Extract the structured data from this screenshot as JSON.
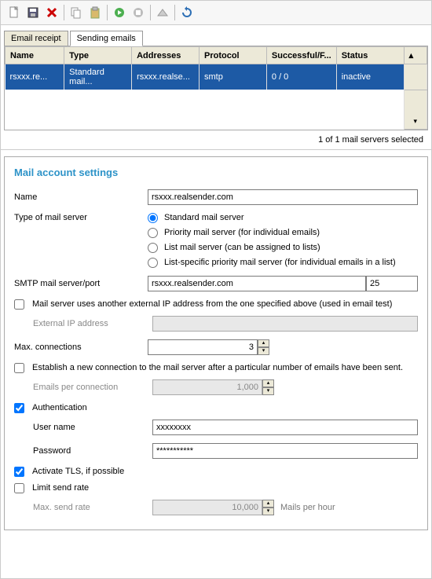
{
  "toolbar": {
    "icons": [
      "new",
      "save",
      "delete",
      "copy",
      "paste",
      "run",
      "stop",
      "send",
      "refresh"
    ]
  },
  "tabs": {
    "email_receipt": "Email receipt",
    "sending_emails": "Sending emails"
  },
  "table": {
    "headers": {
      "name": "Name",
      "type": "Type",
      "addresses": "Addresses",
      "protocol": "Protocol",
      "successful": "Successful/F...",
      "status": "Status"
    },
    "rows": [
      {
        "name": "rsxxx.re...",
        "type": "Standard mail...",
        "addresses": "rsxxx.realse...",
        "protocol": "smtp",
        "successful": "0 / 0",
        "status": "inactive"
      }
    ]
  },
  "status": {
    "text": "1 of 1 mail servers selected"
  },
  "panel": {
    "title": "Mail account settings",
    "labels": {
      "name": "Name",
      "type": "Type of mail server",
      "smtp": "SMTP mail server/port",
      "ext_ip_chk": "Mail server uses another external IP address from the one specified above (used in email test)",
      "ext_ip": "External IP address",
      "max_conn": "Max. connections",
      "establish": "Establish a new connection to the mail server after a particular number of emails have been sent.",
      "emails_per_conn": "Emails per connection",
      "auth": "Authentication",
      "user": "User name",
      "pass": "Password",
      "tls": "Activate TLS, if possible",
      "limit": "Limit send rate",
      "max_rate": "Max. send rate",
      "mails_per_hour": "Mails per hour"
    },
    "values": {
      "name": "rsxxx.realsender.com",
      "smtp_host": "rsxxx.realsender.com",
      "smtp_port": "25",
      "max_conn": "3",
      "emails_per_conn": "1,000",
      "user": "xxxxxxxx",
      "pass": "***********",
      "max_rate": "10,000"
    },
    "radios": {
      "standard": "Standard mail server",
      "priority": "Priority mail server (for individual emails)",
      "list": "List mail server (can be assigned to lists)",
      "list_spec": "List-specific priority mail server (for individual emails in a list)"
    },
    "checks": {
      "ext_ip": false,
      "establish": false,
      "auth": true,
      "tls": true,
      "limit": false
    }
  }
}
